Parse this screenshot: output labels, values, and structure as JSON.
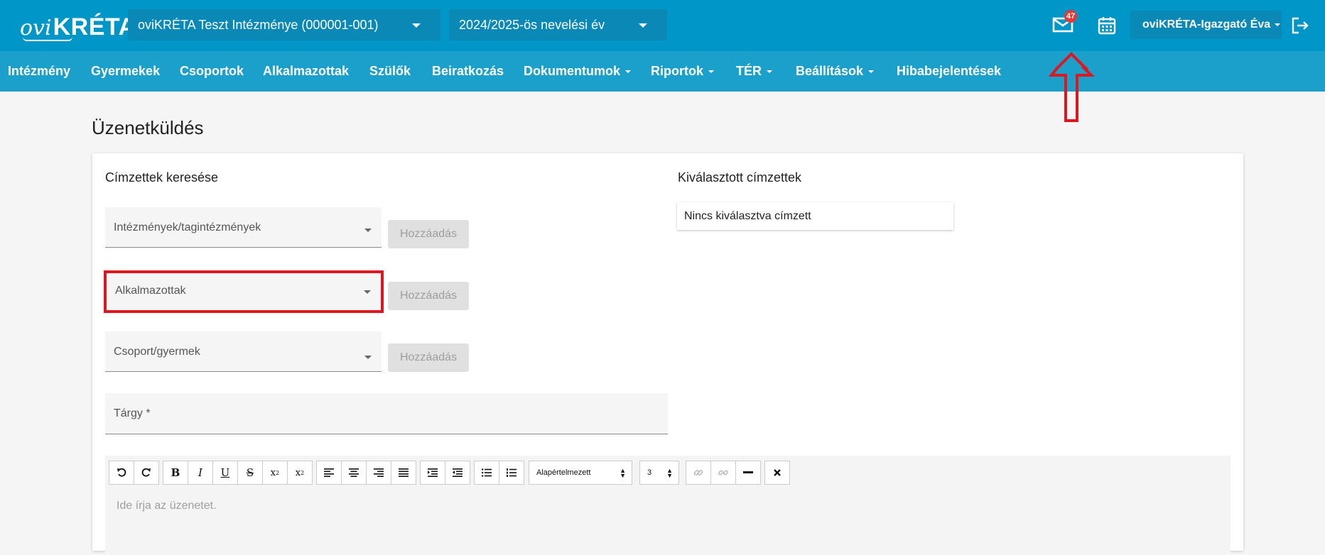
{
  "header": {
    "logo_ovi": "ovi",
    "logo_kreta": "KRÉTA",
    "institution": "oviKRÉTA Teszt Intézménye (000001-001)",
    "year": "2024/2025-ös nevelési év",
    "mail_badge": "47",
    "user": "oviKRÉTA-Igazgató Éva",
    "icons": {
      "mail": "mail-icon",
      "calendar": "calendar-icon",
      "logout": "logout-icon"
    }
  },
  "nav": [
    {
      "label": "Intézmény",
      "dropdown": false
    },
    {
      "label": "Gyermekek",
      "dropdown": false
    },
    {
      "label": "Csoportok",
      "dropdown": false
    },
    {
      "label": "Alkalmazottak",
      "dropdown": false
    },
    {
      "label": "Szülők",
      "dropdown": false
    },
    {
      "label": "Beiratkozás",
      "dropdown": false
    },
    {
      "label": "Dokumentumok",
      "dropdown": true
    },
    {
      "label": "Riportok",
      "dropdown": true
    },
    {
      "label": "TÉR",
      "dropdown": true
    },
    {
      "label": "Beállítások",
      "dropdown": true
    },
    {
      "label": "Hibabejelentések",
      "dropdown": false
    }
  ],
  "page": {
    "title": "Üzenetküldés",
    "search_title": "Címzettek keresése",
    "selected_title": "Kiválasztott címzettek",
    "selected_empty": "Nincs kiválasztva címzett",
    "fields": {
      "institutions": "Intézmények/tagintézmények",
      "employees": "Alkalmazottak",
      "groups": "Csoport/gyermek",
      "subject": "Tárgy *"
    },
    "add_label": "Hozzáadás"
  },
  "editor": {
    "font_select": "Alapértelmezett",
    "size_select": "3",
    "placeholder": "Ide írja az üzenetet."
  },
  "colors": {
    "header": "#0096c7",
    "nav": "#1ba0cc",
    "highlight": "#e0161f",
    "badge": "#e53935"
  }
}
